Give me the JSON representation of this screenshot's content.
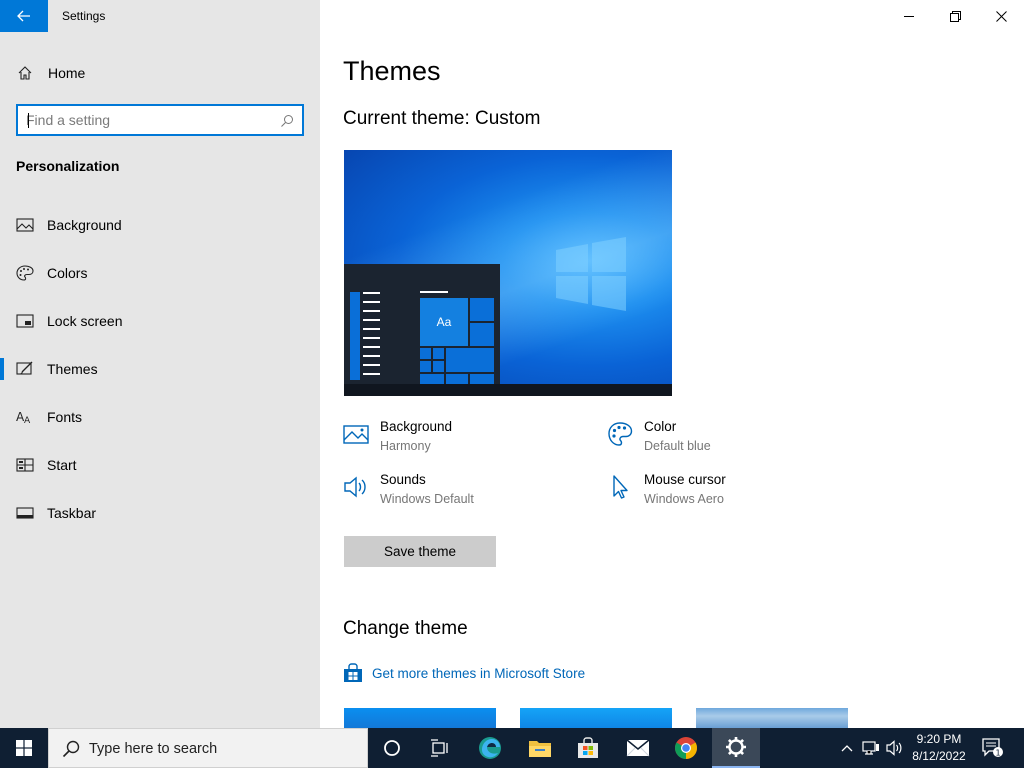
{
  "window": {
    "title": "Settings"
  },
  "sidebar": {
    "home_label": "Home",
    "search_placeholder": "Find a setting",
    "section_title": "Personalization",
    "items": [
      {
        "label": "Background",
        "icon": "picture-icon"
      },
      {
        "label": "Colors",
        "icon": "palette-icon"
      },
      {
        "label": "Lock screen",
        "icon": "lock-screen-icon"
      },
      {
        "label": "Themes",
        "icon": "themes-icon",
        "active": true
      },
      {
        "label": "Fonts",
        "icon": "fonts-icon"
      },
      {
        "label": "Start",
        "icon": "start-icon"
      },
      {
        "label": "Taskbar",
        "icon": "taskbar-icon"
      }
    ]
  },
  "main": {
    "title": "Themes",
    "current_theme": "Current theme: Custom",
    "preview": {
      "tile_label": "Aa"
    },
    "properties": [
      {
        "title": "Background",
        "value": "Harmony",
        "icon": "picture-icon"
      },
      {
        "title": "Color",
        "value": "Default blue",
        "icon": "palette-icon"
      },
      {
        "title": "Sounds",
        "value": "Windows Default",
        "icon": "speaker-icon"
      },
      {
        "title": "Mouse cursor",
        "value": "Windows Aero",
        "icon": "cursor-icon"
      }
    ],
    "save_button": "Save theme",
    "change_theme_title": "Change theme",
    "store_link": "Get more themes in Microsoft Store"
  },
  "taskbar": {
    "search_placeholder": "Type here to search",
    "apps": [
      "cortana-icon",
      "task-view-icon",
      "edge-icon",
      "file-explorer-icon",
      "store-icon",
      "mail-icon",
      "chrome-icon",
      "settings-icon"
    ],
    "time": "9:20 PM",
    "date": "8/12/2022",
    "notification_count": "1"
  },
  "colors": {
    "accent": "#0078d7",
    "sidebar_bg": "#e6e6e6",
    "taskbar_bg": "#0f1f33",
    "link": "#0067b8"
  }
}
